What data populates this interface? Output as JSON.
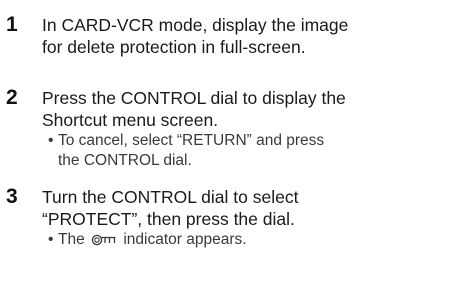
{
  "steps": [
    {
      "number": "1",
      "lines": [
        "In CARD-VCR mode, display the image",
        "for delete protection in full-screen."
      ],
      "notes": []
    },
    {
      "number": "2",
      "lines": [
        "Press the CONTROL dial to display the",
        "Shortcut menu screen."
      ],
      "notes": [
        {
          "bullet": "•",
          "lines": [
            "To cancel, select “RETURN” and press",
            "the CONTROL dial."
          ]
        }
      ]
    },
    {
      "number": "3",
      "lines": [
        "Turn the CONTROL dial to select",
        "“PROTECT”, then press the dial."
      ],
      "notes": [
        {
          "bullet": "•",
          "before_icon": "The",
          "icon": "protect-key-icon",
          "after_icon": "indicator appears."
        }
      ]
    }
  ]
}
